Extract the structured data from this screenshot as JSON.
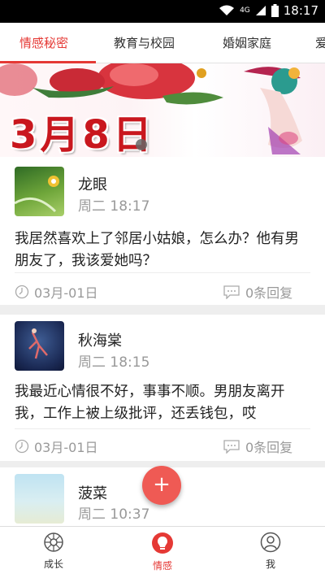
{
  "status_bar": {
    "time": "18:17",
    "network": "4G"
  },
  "tabs": [
    {
      "label": "情感秘密",
      "active": true
    },
    {
      "label": "教育与校园",
      "active": false
    },
    {
      "label": "婚姻家庭",
      "active": false
    },
    {
      "label": "爱",
      "active": false
    }
  ],
  "banner": {
    "date_text": "3月8日"
  },
  "posts": [
    {
      "username": "龙眼",
      "time": "周二   18:17",
      "content": "我居然喜欢上了邻居小姑娘，怎么办？他有男朋友了，我该爱她吗？",
      "date": "03月-01日",
      "replies": "0条回复"
    },
    {
      "username": "秋海棠",
      "time": "周二   18:15",
      "content": "我最近心情很不好，事事不顺。男朋友离开我，工作上被上级批评，还丢钱包，哎",
      "date": "03月-01日",
      "replies": "0条回复"
    },
    {
      "username": "菠菜",
      "time": "周二   10:37"
    }
  ],
  "fab": {
    "label": "+"
  },
  "bottom_nav": [
    {
      "label": "成长",
      "icon": "growth-icon",
      "active": false
    },
    {
      "label": "情感",
      "icon": "lightbulb-icon",
      "active": true
    },
    {
      "label": "我",
      "icon": "profile-icon",
      "active": false
    }
  ],
  "colors": {
    "accent": "#e53935",
    "fab": "#ef5a54"
  }
}
